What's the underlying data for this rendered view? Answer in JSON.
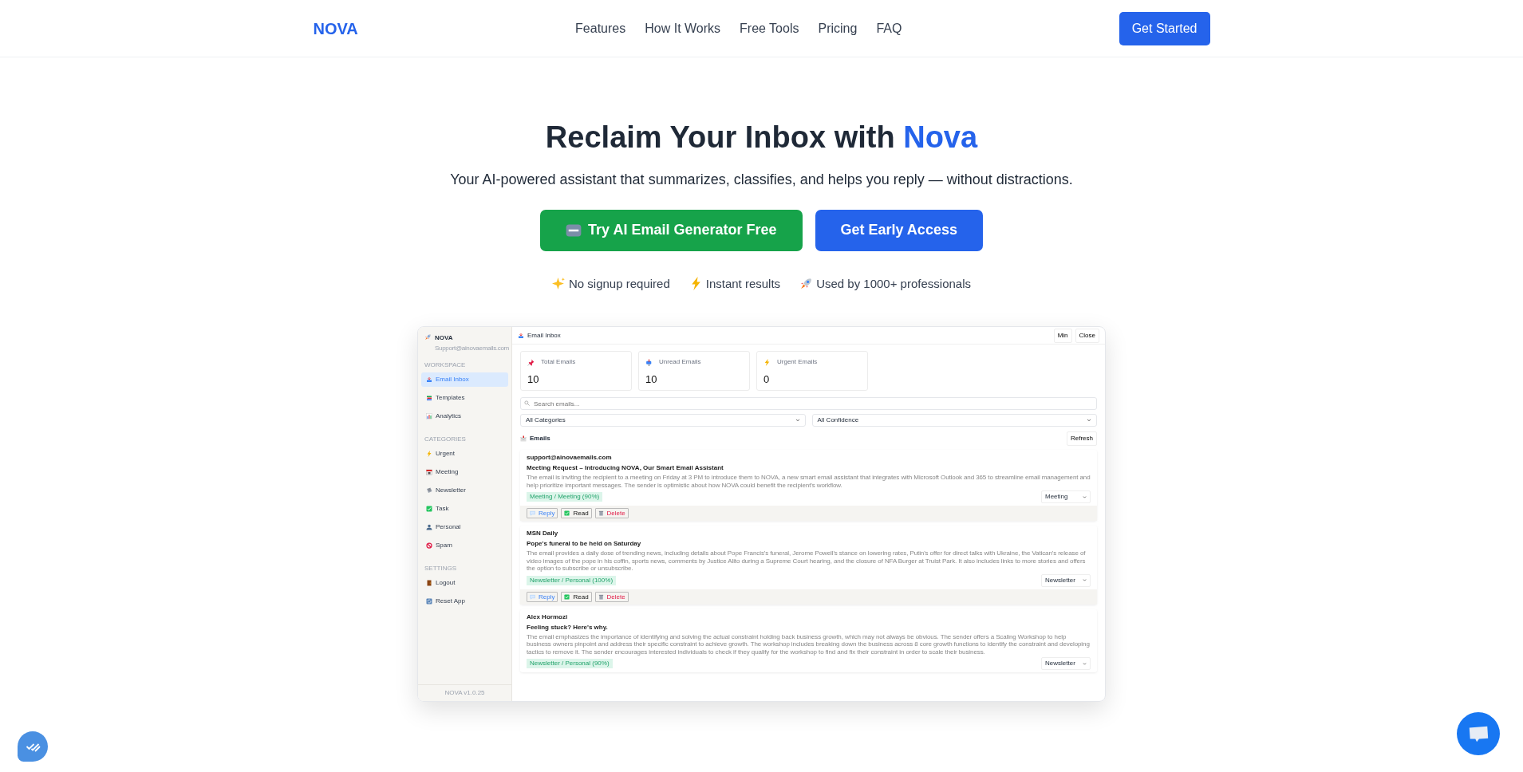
{
  "navbar": {
    "logo": "NOVA",
    "links": [
      "Features",
      "How It Works",
      "Free Tools",
      "Pricing",
      "FAQ"
    ],
    "cta": "Get Started"
  },
  "hero": {
    "title_start": "Reclaim Your Inbox with ",
    "title_accent": "Nova",
    "subtitle": "Your AI-powered assistant that summarizes, classifies, and helps you reply — without distractions.",
    "buttons": [
      {
        "label": "Try AI Email Generator Free",
        "kind": "success"
      },
      {
        "label": "Get Early Access",
        "kind": "primary"
      }
    ],
    "features": [
      "No signup required",
      "Instant results",
      "Used by 1000+ professionals"
    ]
  },
  "app": {
    "brand": "NOVA",
    "email": "Support@ainovaemails.com",
    "version": "NOVA v1.0.25",
    "sections": [
      {
        "heading": "WORKSPACE",
        "items": [
          {
            "label": "Email Inbox",
            "selected": true
          },
          {
            "label": "Templates",
            "selected": false
          },
          {
            "label": "Analytics",
            "selected": false
          }
        ]
      },
      {
        "heading": "CATEGORIES",
        "items": [
          {
            "label": "Urgent",
            "selected": false
          },
          {
            "label": "Meeting",
            "selected": false
          },
          {
            "label": "Newsletter",
            "selected": false
          },
          {
            "label": "Task",
            "selected": false
          },
          {
            "label": "Personal",
            "selected": false
          },
          {
            "label": "Spam",
            "selected": false
          }
        ]
      },
      {
        "heading": "SETTINGS",
        "items": [
          {
            "label": "Logout",
            "selected": false
          },
          {
            "label": "Reset App",
            "selected": false
          }
        ]
      }
    ],
    "title": "Email Inbox",
    "window_buttons": [
      "Min",
      "Close"
    ],
    "stats": [
      {
        "label": "Total Emails",
        "value": "10"
      },
      {
        "label": "Unread Emails",
        "value": "10"
      },
      {
        "label": "Urgent Emails",
        "value": "0"
      }
    ],
    "search": {
      "placeholder": "Search emails..."
    },
    "filters": [
      "All Categories",
      "All Confidence"
    ],
    "list_title": "Emails",
    "refresh": "Refresh",
    "emails": [
      {
        "sender": "support@ainovaemails.com",
        "subject": "Meeting Request – Introducing NOVA, Our Smart Email Assistant",
        "summary": "The email is inviting the recipient to a meeting on Friday at 3 PM to introduce them to NOVA, a new smart email assistant that integrates with Microsoft Outlook and 365 to streamline email management and help prioritize important messages. The sender is optimistic about how NOVA could benefit the recipient's workflow.",
        "tag": "Meeting / Meeting (90%)",
        "category": "Meeting",
        "actions": [
          "Reply",
          "Read",
          "Delete"
        ]
      },
      {
        "sender": "MSN Daily",
        "subject": "Pope's funeral to be held on Saturday",
        "summary": "The email provides a daily dose of trending news, including details about Pope Francis's funeral, Jerome Powell's stance on lowering rates, Putin's offer for direct talks with Ukraine, the Vatican's release of video images of the pope in his coffin, sports news, comments by Justice Alito during a Supreme Court hearing, and the closure of NFA Burger at Truist Park. It also includes links to more stories and offers the option to subscribe or unsubscribe.",
        "tag": "Newsletter / Personal (100%)",
        "category": "Newsletter",
        "actions": [
          "Reply",
          "Read",
          "Delete"
        ]
      },
      {
        "sender": "Alex Hormozi",
        "subject": "Feeling stuck? Here's why.",
        "summary": "The email emphasizes the importance of identifying and solving the actual constraint holding back business growth, which may not always be obvious. The sender offers a Scaling Workshop to help business owners pinpoint and address their specific constraint to achieve growth. The workshop includes breaking down the business across 8 core growth functions to identify the constraint and developing tactics to remove it. The sender encourages interested individuals to check if they qualify for the workshop to find and fix their constraint in order to scale their business.",
        "tag": "Newsletter / Personal (90%)",
        "category": "Newsletter"
      }
    ]
  }
}
